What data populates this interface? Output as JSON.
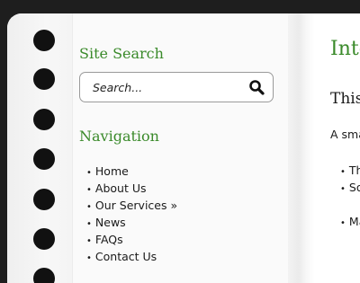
{
  "search": {
    "title": "Site Search",
    "placeholder": "Search..."
  },
  "navigation": {
    "title": "Navigation",
    "items": [
      {
        "label": "Home"
      },
      {
        "label": "About Us"
      },
      {
        "label": "Our Services »"
      },
      {
        "label": "News"
      },
      {
        "label": "FAQs"
      },
      {
        "label": "Contact Us"
      }
    ]
  },
  "content": {
    "title": "Inte",
    "subtitle": "This",
    "paragraph": "A sma",
    "list_a": [
      "Th",
      "So"
    ],
    "list_b": [
      "Ma"
    ]
  },
  "colors": {
    "accent": "#3a8a2a",
    "background": "#1e1e1e",
    "binding_hole": "#111111"
  }
}
